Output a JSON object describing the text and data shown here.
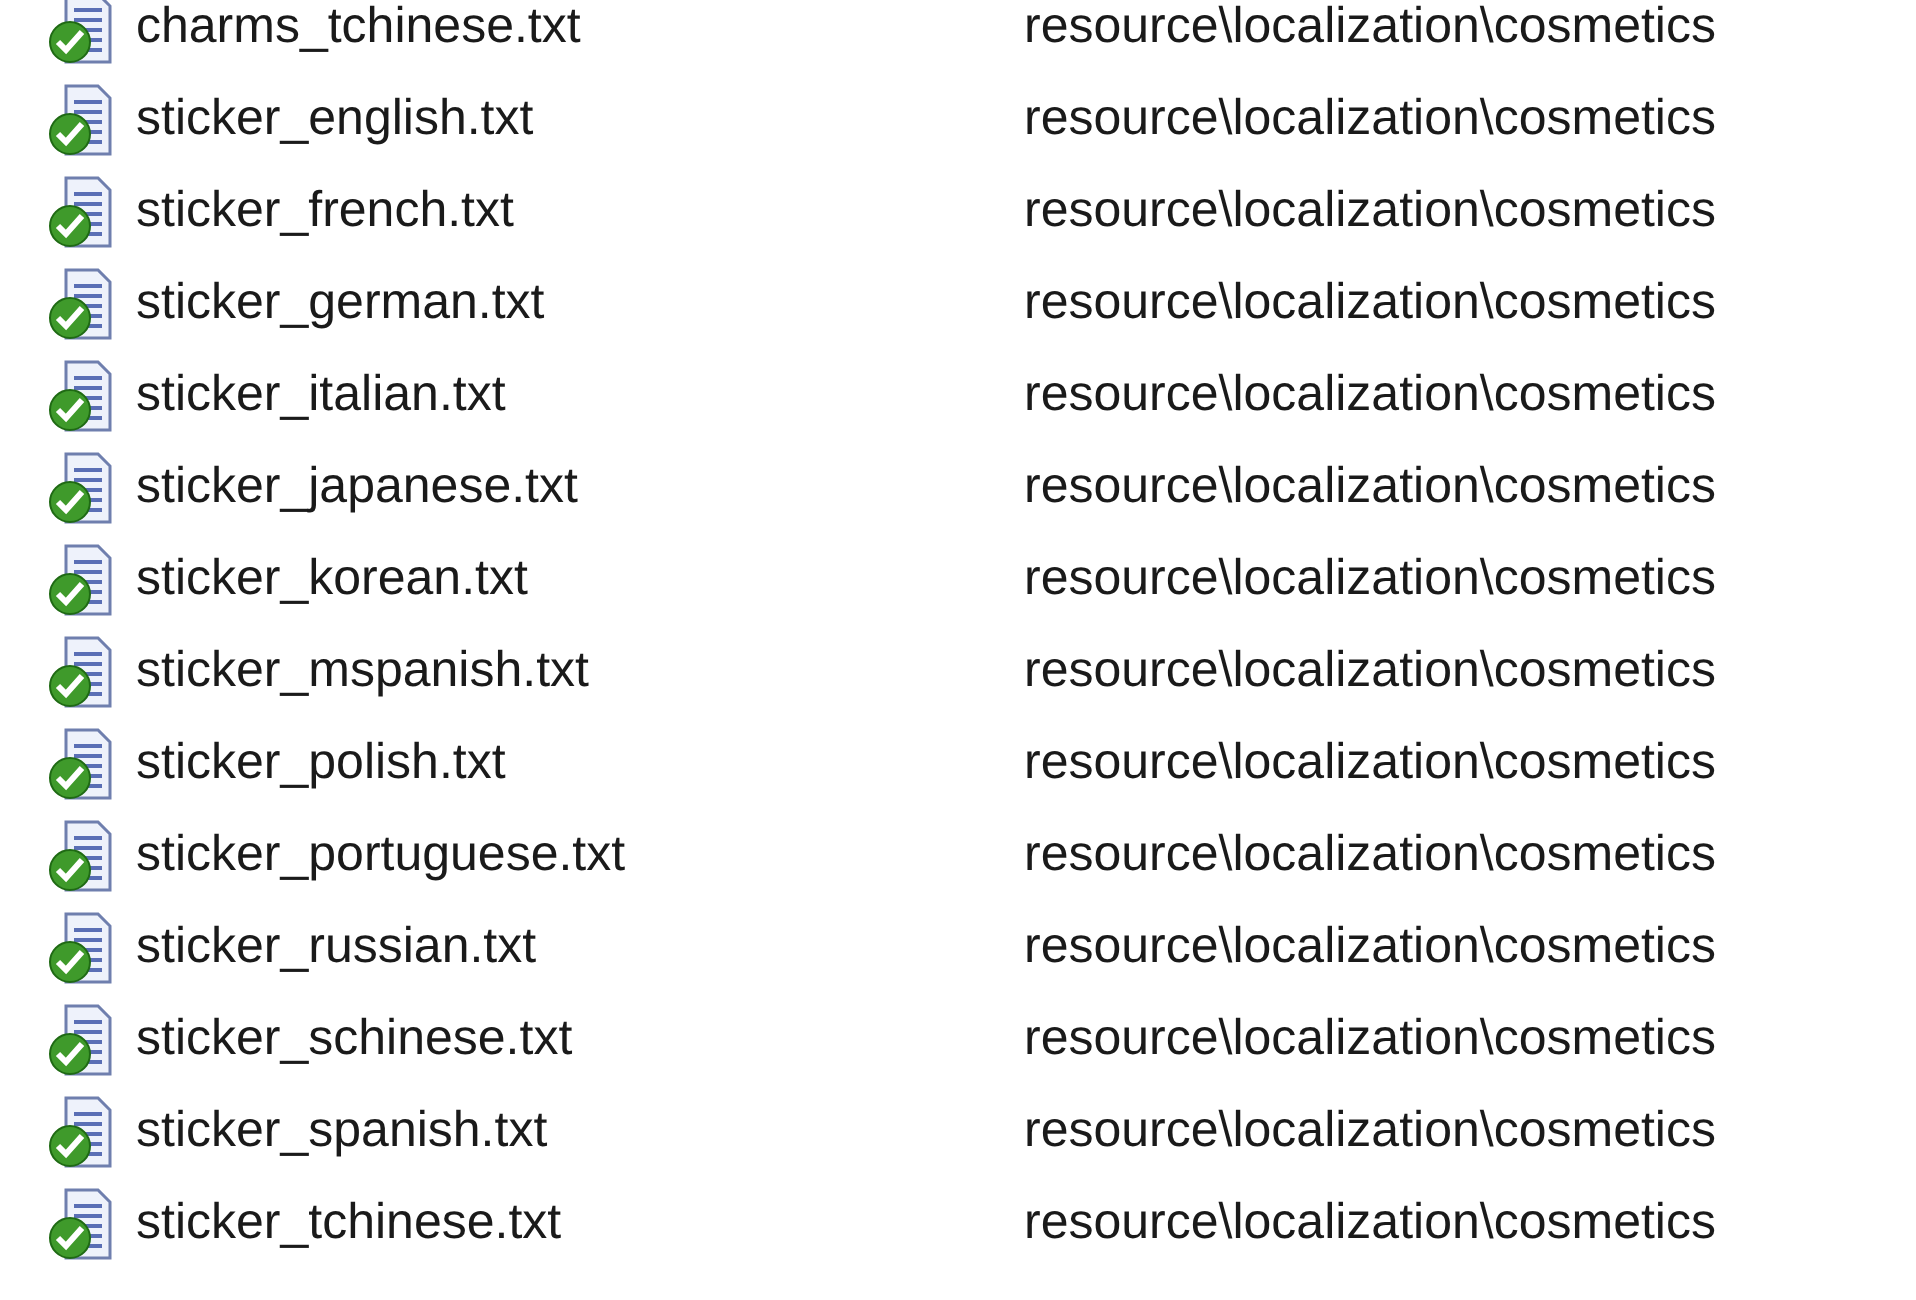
{
  "files": [
    {
      "name": "charms_tchinese.txt",
      "folder": "resource\\localization\\cosmetics",
      "synced": true
    },
    {
      "name": "sticker_english.txt",
      "folder": "resource\\localization\\cosmetics",
      "synced": true
    },
    {
      "name": "sticker_french.txt",
      "folder": "resource\\localization\\cosmetics",
      "synced": true
    },
    {
      "name": "sticker_german.txt",
      "folder": "resource\\localization\\cosmetics",
      "synced": true
    },
    {
      "name": "sticker_italian.txt",
      "folder": "resource\\localization\\cosmetics",
      "synced": true
    },
    {
      "name": "sticker_japanese.txt",
      "folder": "resource\\localization\\cosmetics",
      "synced": true
    },
    {
      "name": "sticker_korean.txt",
      "folder": "resource\\localization\\cosmetics",
      "synced": true
    },
    {
      "name": "sticker_mspanish.txt",
      "folder": "resource\\localization\\cosmetics",
      "synced": true
    },
    {
      "name": "sticker_polish.txt",
      "folder": "resource\\localization\\cosmetics",
      "synced": true
    },
    {
      "name": "sticker_portuguese.txt",
      "folder": "resource\\localization\\cosmetics",
      "synced": true
    },
    {
      "name": "sticker_russian.txt",
      "folder": "resource\\localization\\cosmetics",
      "synced": true
    },
    {
      "name": "sticker_schinese.txt",
      "folder": "resource\\localization\\cosmetics",
      "synced": true
    },
    {
      "name": "sticker_spanish.txt",
      "folder": "resource\\localization\\cosmetics",
      "synced": true
    },
    {
      "name": "sticker_tchinese.txt",
      "folder": "resource\\localization\\cosmetics",
      "synced": true
    }
  ]
}
